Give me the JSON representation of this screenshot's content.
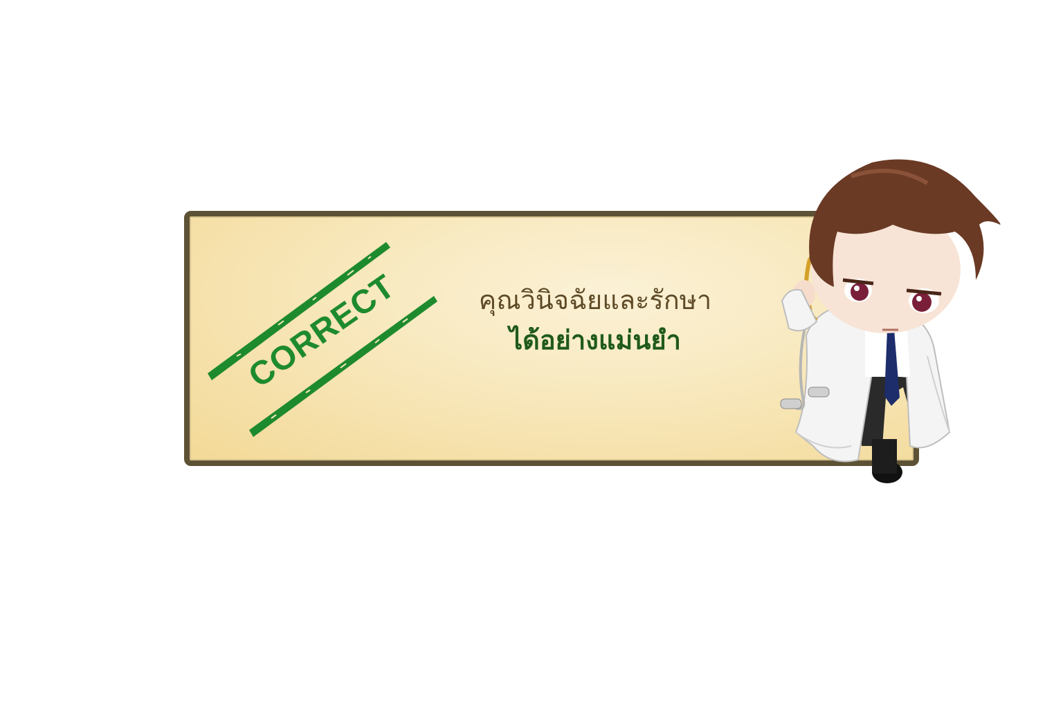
{
  "result_stamp": {
    "text": "CORRECT",
    "color": "#1e8a2e"
  },
  "message": {
    "line1": "คุณวินิจฉัยและรักษา",
    "line2": "ได้อย่างแม่นยำ",
    "line1_color": "#5e4a26",
    "line2_color": "#1f5a1a"
  },
  "panel": {
    "border_color": "#5e5236",
    "fill_color": "#f8e9bf"
  },
  "character": {
    "icon": "doctor-chibi-icon"
  }
}
